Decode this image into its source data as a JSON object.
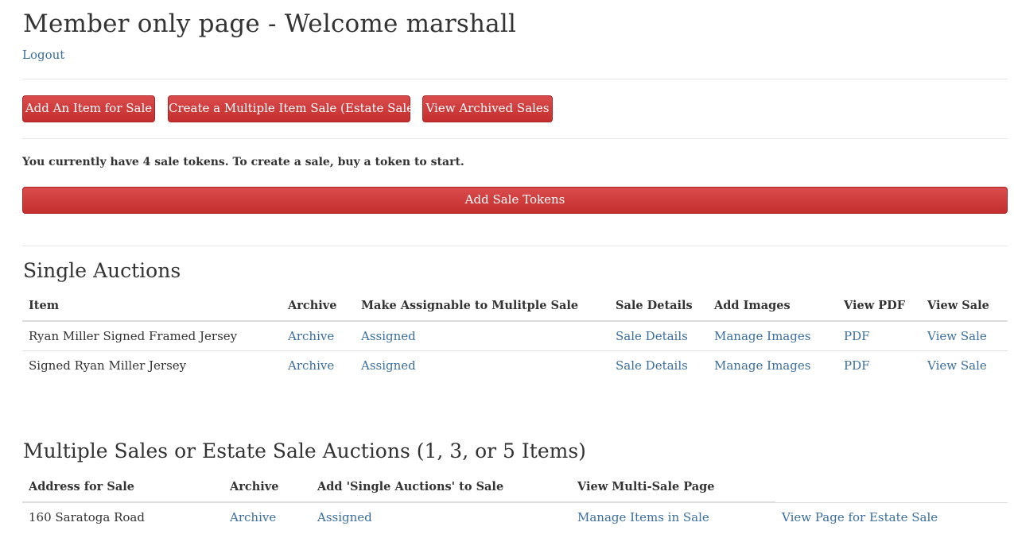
{
  "page": {
    "title": "Member only page - Welcome marshall",
    "logout": "Logout"
  },
  "actions": {
    "add_item": "Add An Item for Sale",
    "create_multi": "Create a Multiple Item Sale (Estate Sales)",
    "view_archived": "View Archived Sales"
  },
  "tokens": {
    "message": "You currently have 4 sale tokens. To create a sale, buy a token to start.",
    "add_button": "Add Sale Tokens"
  },
  "single": {
    "heading": "Single Auctions",
    "columns": [
      "Item",
      "Archive",
      "Make Assignable to Mulitple Sale",
      "Sale Details",
      "Add Images",
      "View PDF",
      "View Sale"
    ],
    "rows": [
      {
        "item": "Ryan Miller Signed Framed Jersey",
        "archive": "Archive",
        "assign": "Assigned",
        "details": "Sale Details",
        "images": "Manage Images",
        "pdf": "PDF",
        "view": "View Sale"
      },
      {
        "item": "Signed Ryan Miller Jersey",
        "archive": "Archive",
        "assign": "Assigned",
        "details": "Sale Details",
        "images": "Manage Images",
        "pdf": "PDF",
        "view": "View Sale"
      }
    ]
  },
  "multi": {
    "heading": "Multiple Sales or Estate Sale Auctions (1, 3, or 5 Items)",
    "columns": [
      "Address for Sale",
      "Archive",
      "Add 'Single Auctions' to Sale",
      "View Multi-Sale Page"
    ],
    "rows": [
      {
        "address": "160 Saratoga Road",
        "archive": "Archive",
        "assign": "Assigned",
        "manage": "Manage Items in Sale",
        "view": "View Page for Estate Sale"
      }
    ]
  }
}
